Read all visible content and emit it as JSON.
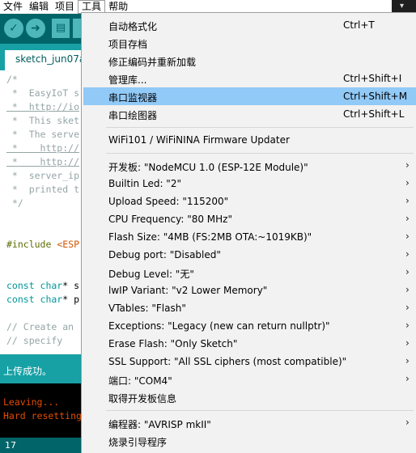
{
  "menubar": {
    "items": [
      "文件",
      "编辑",
      "项目",
      "工具",
      "帮助"
    ],
    "active_index": 3
  },
  "tab": {
    "label": "sketch_jun07a"
  },
  "code": {
    "lines": [
      {
        "text": "/*",
        "cls": "c-comment"
      },
      {
        "text": " *  EasyIoT s",
        "cls": "c-comment"
      },
      {
        "text": " *  http://io",
        "cls": "c-link"
      },
      {
        "text": " *  This sket",
        "cls": "c-comment"
      },
      {
        "text": " *  The serve",
        "cls": "c-comment"
      },
      {
        "text": " *    http://",
        "cls": "c-link"
      },
      {
        "text": " *    http://",
        "cls": "c-link"
      },
      {
        "text": " *  server_ip",
        "cls": "c-comment"
      },
      {
        "text": " *  printed t",
        "cls": "c-comment"
      },
      {
        "text": " */",
        "cls": "c-comment"
      },
      {
        "text": "",
        "cls": ""
      },
      {
        "text": "",
        "cls": ""
      },
      {
        "text": "#include <ESP",
        "cls": "inc"
      },
      {
        "text": "",
        "cls": ""
      },
      {
        "text": "",
        "cls": ""
      },
      {
        "text": "const char* s",
        "cls": "kw"
      },
      {
        "text": "const char* p",
        "cls": "kw"
      },
      {
        "text": "",
        "cls": ""
      },
      {
        "text": "// Create an",
        "cls": "c-comment"
      },
      {
        "text": "// specify",
        "cls": "c-comment"
      }
    ]
  },
  "status": {
    "text": "上传成功。"
  },
  "console": {
    "lines": [
      "Leaving...",
      "Hard resetting"
    ]
  },
  "bottom": {
    "line_number": "17"
  },
  "menu": {
    "groups": [
      [
        {
          "label": "自动格式化",
          "shortcut": "Ctrl+T"
        },
        {
          "label": "项目存档",
          "shortcut": ""
        },
        {
          "label": "修正编码并重新加载",
          "shortcut": ""
        },
        {
          "label": "管理库...",
          "shortcut": "Ctrl+Shift+I"
        },
        {
          "label": "串口监视器",
          "shortcut": "Ctrl+Shift+M",
          "highlight": true
        },
        {
          "label": "串口绘图器",
          "shortcut": "Ctrl+Shift+L"
        }
      ],
      [
        {
          "label": "WiFi101 / WiFiNINA Firmware Updater",
          "shortcut": ""
        }
      ],
      [
        {
          "label": "开发板: \"NodeMCU 1.0 (ESP-12E Module)\"",
          "submenu": true
        },
        {
          "label": "Builtin Led: \"2\"",
          "submenu": true
        },
        {
          "label": "Upload Speed: \"115200\"",
          "submenu": true
        },
        {
          "label": "CPU Frequency: \"80 MHz\"",
          "submenu": true
        },
        {
          "label": "Flash Size: \"4MB (FS:2MB OTA:~1019KB)\"",
          "submenu": true
        },
        {
          "label": "Debug port: \"Disabled\"",
          "submenu": true
        },
        {
          "label": "Debug Level: \"无\"",
          "submenu": true
        },
        {
          "label": "lwIP Variant: \"v2 Lower Memory\"",
          "submenu": true
        },
        {
          "label": "VTables: \"Flash\"",
          "submenu": true
        },
        {
          "label": "Exceptions: \"Legacy (new can return nullptr)\"",
          "submenu": true
        },
        {
          "label": "Erase Flash: \"Only Sketch\"",
          "submenu": true
        },
        {
          "label": "SSL Support: \"All SSL ciphers (most compatible)\"",
          "submenu": true
        },
        {
          "label": "端口: \"COM4\"",
          "submenu": true
        },
        {
          "label": "取得开发板信息",
          "submenu": false
        }
      ],
      [
        {
          "label": "编程器: \"AVRISP mkII\"",
          "submenu": true
        },
        {
          "label": "烧录引导程序",
          "submenu": false
        }
      ]
    ]
  },
  "colors": {
    "toolbar": "#006468",
    "tabbar": "#17a1a5",
    "highlight": "#91c9f7",
    "menu_bg": "#f2f2f2"
  }
}
